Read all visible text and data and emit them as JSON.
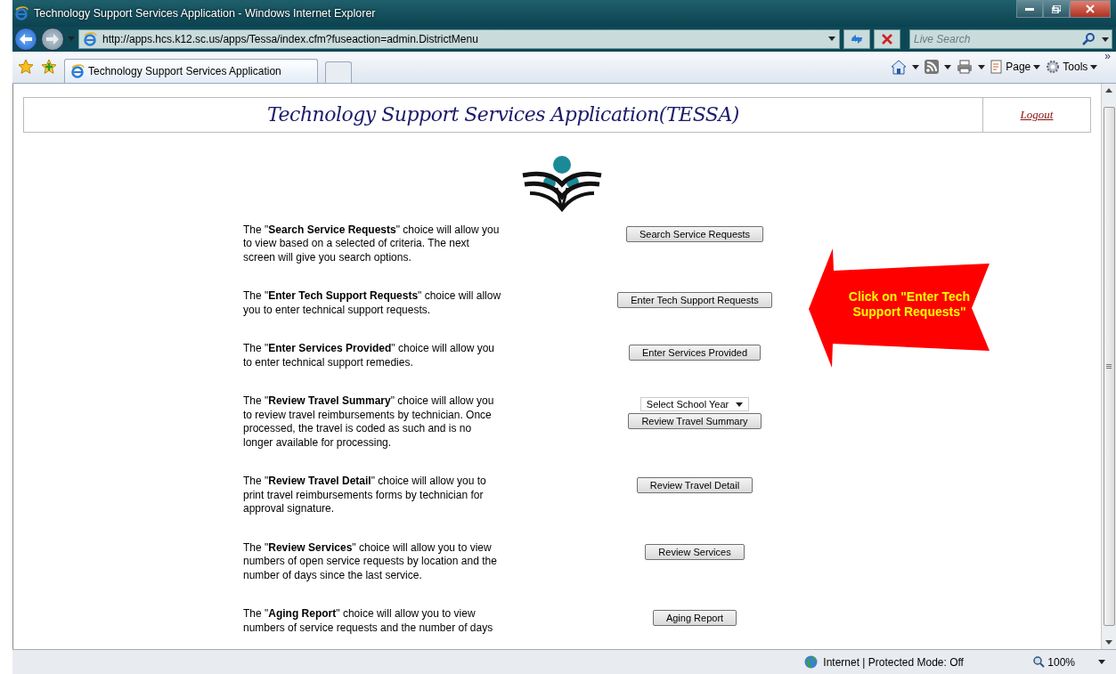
{
  "window": {
    "title": "Technology Support Services Application - Windows Internet Explorer"
  },
  "address_bar": {
    "url": "http://apps.hcs.k12.sc.us/apps/Tessa/index.cfm?fuseaction=admin.DistrictMenu"
  },
  "search": {
    "placeholder": "Live Search"
  },
  "tabs": [
    {
      "label": "Technology Support Services Application",
      "selected": true
    }
  ],
  "toolbar": {
    "page_label": "Page",
    "tools_label": "Tools",
    "overflow": "»"
  },
  "page": {
    "title": "Technology Support Services Application(TESSA)",
    "logout": "Logout",
    "menu": [
      {
        "kind": "button",
        "description": "The \"**Search Service Requests**\" choice will allow you to view based on a selected of criteria. The next screen will give you search options.",
        "button": "Search Service Requests"
      },
      {
        "kind": "button",
        "description": "The \"**Enter Tech Support Requests**\" choice will allow you to enter technical support requests.",
        "button": "Enter Tech Support Requests"
      },
      {
        "kind": "button",
        "description": "The \"**Enter Services Provided**\" choice will allow you to enter technical support remedies.",
        "button": "Enter Services Provided"
      },
      {
        "kind": "select-button",
        "description": "The \"**Review Travel Summary**\" choice will allow you to review travel reimbursements by technician. Once processed, the travel is coded as such and is no longer available for processing.",
        "select": "Select School Year",
        "button": "Review Travel Summary"
      },
      {
        "kind": "button",
        "description": "The \"**Review Travel Detail**\" choice will allow you to print travel reimbursements forms by technician for approval signature.",
        "button": "Review Travel Detail"
      },
      {
        "kind": "button",
        "description": "The \"**Review Services**\" choice will allow you to view numbers of open service requests by location and the number of days since the last service.",
        "button": "Review Services"
      },
      {
        "kind": "button",
        "description": "The \"**Aging Report**\" choice will allow you to view numbers of service requests and the number of days",
        "button": "Aging Report"
      }
    ],
    "callout": "Click on \"Enter Tech Support Requests\""
  },
  "status_bar": {
    "zone": "Internet | Protected Mode: Off",
    "zoom": "100%"
  }
}
